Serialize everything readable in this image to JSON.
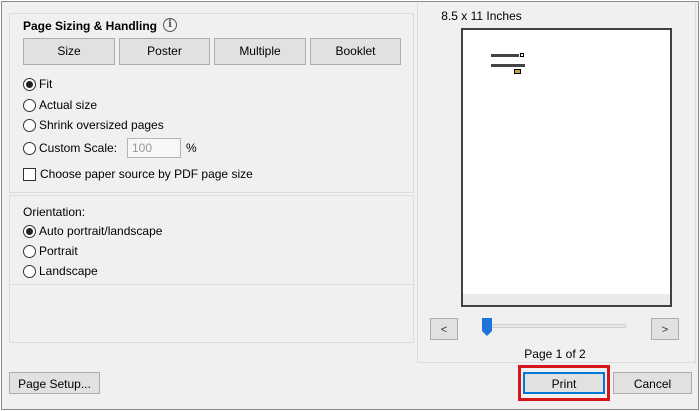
{
  "sizing": {
    "title": "Page Sizing & Handling",
    "info_icon": "info-icon",
    "modes": [
      "Size",
      "Poster",
      "Multiple",
      "Booklet"
    ],
    "selected_mode": "Size",
    "options": [
      "Fit",
      "Actual size",
      "Shrink oversized pages",
      "Custom Scale:"
    ],
    "selected_option": "Fit",
    "custom_scale_value": "100",
    "percent_symbol": "%",
    "paper_source_label": "Choose paper source by PDF page size",
    "paper_source_checked": false
  },
  "orientation": {
    "label": "Orientation:",
    "options": [
      "Auto portrait/landscape",
      "Portrait",
      "Landscape"
    ],
    "selected": "Auto portrait/landscape"
  },
  "preview": {
    "paper_size": "8.5 x 11 Inches",
    "prev_icon": "chevron-left-icon",
    "next_icon": "chevron-right-icon",
    "prev_glyph": "<",
    "next_glyph": ">",
    "page_counter": "Page 1 of 2",
    "current_page": 1,
    "total_pages": 2
  },
  "footer": {
    "page_setup_label": "Page Setup...",
    "print_label": "Print",
    "cancel_label": "Cancel"
  },
  "colors": {
    "dialog_bg": "#f0f0f0",
    "button_bg": "#e1e1e1",
    "focus_blue": "#0078d7",
    "slider_blue": "#1e74d9",
    "highlight_red": "#d6151b"
  }
}
